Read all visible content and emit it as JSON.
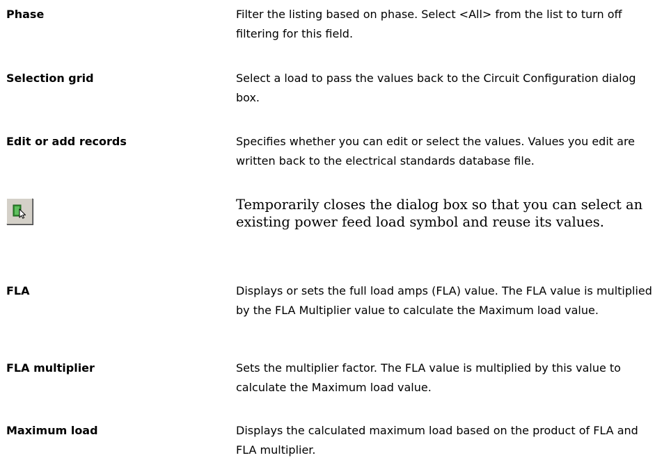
{
  "rows": [
    {
      "term": "Phase",
      "description": "Filter the listing based on phase. Select <All> from the list to turn off filtering for this field."
    },
    {
      "term": "Selection grid",
      "description": "Select a load to pass the values back to the Circuit Configuration dialog box."
    },
    {
      "term": "Edit or add records",
      "description": "Specifies whether you can edit or select the values. Values you edit are written back to the electrical standards database file."
    },
    {
      "icon": "select-object-icon",
      "description": "Temporarily closes the dialog box so that you can select an existing power feed load symbol and reuse its values."
    },
    {
      "term": "FLA",
      "description": "Displays or sets the full load amps (FLA) value. The FLA value is multiplied by the FLA Multiplier value to calculate the Maximum load value."
    },
    {
      "term": "FLA multiplier",
      "description": "Sets the multiplier factor. The FLA value is multiplied by this value to calculate the Maximum load value."
    },
    {
      "term": "Maximum load",
      "description": "Displays the calculated maximum load based on the product of FLA and FLA multiplier."
    }
  ],
  "colors": {
    "icon_green": "#2f8a2f",
    "button_face": "#d4d0c8"
  }
}
